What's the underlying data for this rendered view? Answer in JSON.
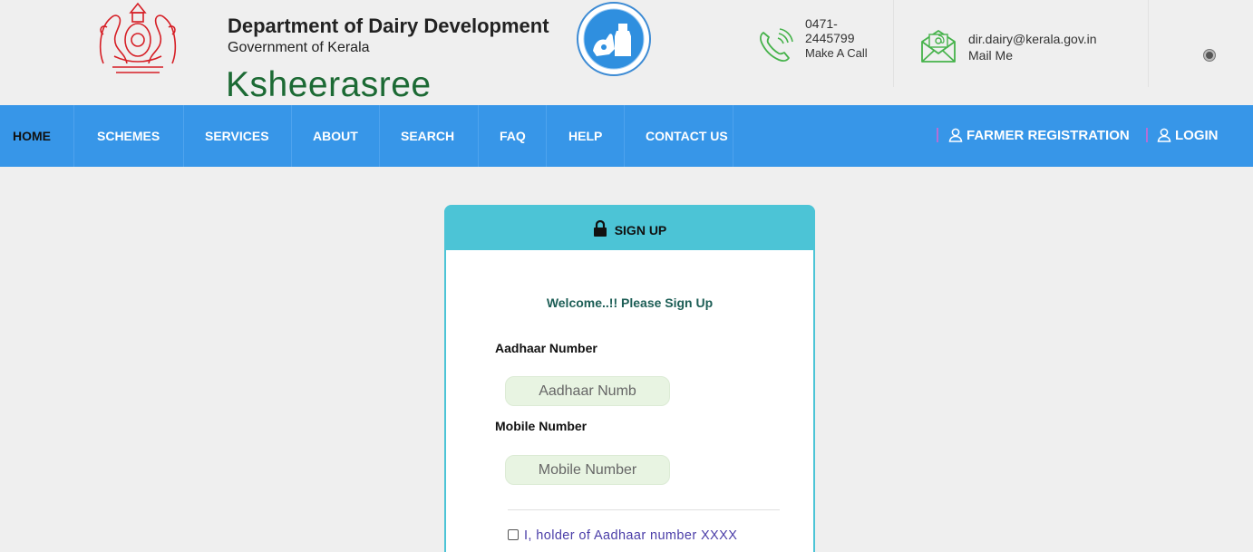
{
  "header": {
    "dept_title": "Department of Dairy Development",
    "dept_subtitle": "Government of Kerala",
    "brand": "Ksheerasree",
    "phone_number": "0471-2445799",
    "phone_cta": "Make A Call",
    "email": "dir.dairy@kerala.gov.in",
    "email_cta": "Mail Me"
  },
  "nav": {
    "items": [
      "HOME",
      "SCHEMES",
      "SERVICES",
      "ABOUT",
      "SEARCH",
      "FAQ",
      "HELP",
      "CONTACT US"
    ],
    "active": "HOME",
    "farmer_registration": "FARMER REGISTRATION",
    "login": "LOGIN"
  },
  "signup": {
    "title": "SIGN UP",
    "welcome": "Welcome..!! Please Sign Up",
    "aadhaar_label": "Aadhaar Number",
    "aadhaar_placeholder": "Aadhaar Numb",
    "mobile_label": "Mobile Number",
    "mobile_placeholder": "Mobile Number",
    "consent_text": "I, holder of Aadhaar number XXXX"
  },
  "colors": {
    "nav_bg": "#3796e8",
    "card_header": "#4cc4d6",
    "brand_green": "#1c6a34",
    "input_bg": "#e8f4e2",
    "consent_text": "#4b3ea8"
  }
}
